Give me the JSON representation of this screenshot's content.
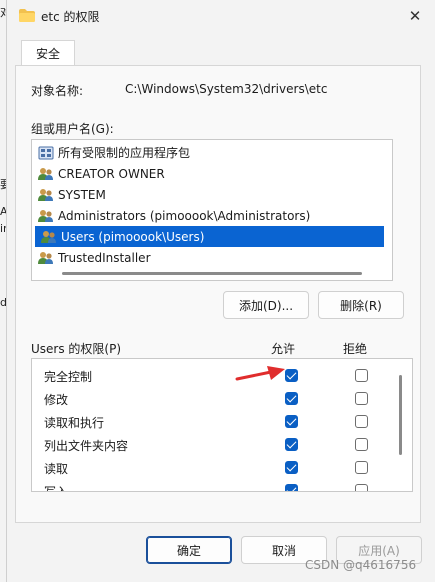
{
  "background_fragments": [
    "对",
    "要",
    "AL",
    "ir",
    "d"
  ],
  "window": {
    "title": "etc 的权限",
    "close_glyph": "✕"
  },
  "tabs": [
    {
      "label": "安全"
    }
  ],
  "object_name": {
    "label": "对象名称:",
    "value": "C:\\Windows\\System32\\drivers\\etc"
  },
  "groups": {
    "label": "组或用户名(G):",
    "items": [
      {
        "label": "所有受限制的应用程序包",
        "icon": "package-icon",
        "selected": false
      },
      {
        "label": "CREATOR OWNER",
        "icon": "users-icon",
        "selected": false
      },
      {
        "label": "SYSTEM",
        "icon": "users-icon",
        "selected": false
      },
      {
        "label": "Administrators (pimooook\\Administrators)",
        "icon": "users-icon",
        "selected": false
      },
      {
        "label": "Users (pimooook\\Users)",
        "icon": "users-icon",
        "selected": true
      },
      {
        "label": "TrustedInstaller",
        "icon": "users-icon",
        "selected": false
      }
    ]
  },
  "buttons": {
    "add": "添加(D)...",
    "remove": "删除(R)",
    "ok": "确定",
    "cancel": "取消",
    "apply": "应用(A)"
  },
  "permissions": {
    "title": "Users 的权限(P)",
    "allow_header": "允许",
    "deny_header": "拒绝",
    "rows": [
      {
        "label": "完全控制",
        "allow": true,
        "deny": false
      },
      {
        "label": "修改",
        "allow": true,
        "deny": false
      },
      {
        "label": "读取和执行",
        "allow": true,
        "deny": false
      },
      {
        "label": "列出文件夹内容",
        "allow": true,
        "deny": false
      },
      {
        "label": "读取",
        "allow": true,
        "deny": false
      },
      {
        "label": "写入",
        "allow": true,
        "deny": false
      }
    ]
  },
  "annotation": {
    "icon": "red-arrow-icon",
    "color": "#e02d2d"
  },
  "watermark": "CSDN @q4616756",
  "colors": {
    "accent": "#0a64d2",
    "checkbox": "#0a5fc4"
  }
}
